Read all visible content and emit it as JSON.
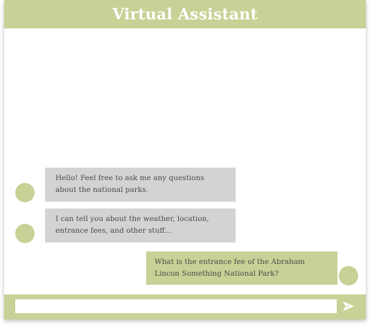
{
  "header": {
    "title": "Virtual Assistant"
  },
  "messages": [
    {
      "sender": "bot",
      "text": "Hello! Feel free to ask me any questions about the national parks."
    },
    {
      "sender": "bot",
      "text": "I can tell you about the weather, location, entrance fees, and other stuff..."
    },
    {
      "sender": "user",
      "text": "What is the entrance fee of the Abraham Lincon Something National Park?"
    }
  ],
  "composer": {
    "value": "",
    "placeholder": "",
    "send_icon": "send-icon"
  },
  "colors": {
    "accent": "#c8d196",
    "bot_bubble": "#d3d3d3",
    "text": "#4a4a4a",
    "header_text": "#ffffff"
  }
}
